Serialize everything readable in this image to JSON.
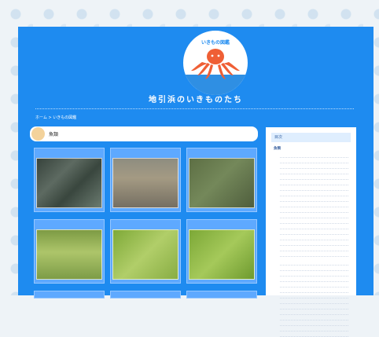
{
  "header": {
    "logo_title": "いきもの図鑑",
    "site_title": "地引浜のいきものたち"
  },
  "breadcrumb": {
    "text": "ホーム > いきもの図鑑"
  },
  "main": {
    "section_label": "魚類",
    "cards": [
      {
        "title": ""
      },
      {
        "title": ""
      },
      {
        "title": ""
      },
      {
        "title": ""
      },
      {
        "title": ""
      },
      {
        "title": ""
      }
    ],
    "bottom_cards": [
      {
        "title": ""
      },
      {
        "title": ""
      },
      {
        "title": ""
      }
    ]
  },
  "sidebar": {
    "header_label": "目次",
    "sections": [
      {
        "title": "魚類",
        "items": [
          "",
          "",
          "",
          "",
          "",
          "",
          "",
          "",
          "",
          "",
          "",
          "",
          "",
          "",
          "",
          "",
          "",
          "",
          ""
        ]
      },
      {
        "title": "",
        "items": [
          "",
          "",
          "",
          "",
          "",
          "",
          "",
          "",
          "",
          "",
          "",
          "",
          "",
          ""
        ]
      }
    ]
  }
}
